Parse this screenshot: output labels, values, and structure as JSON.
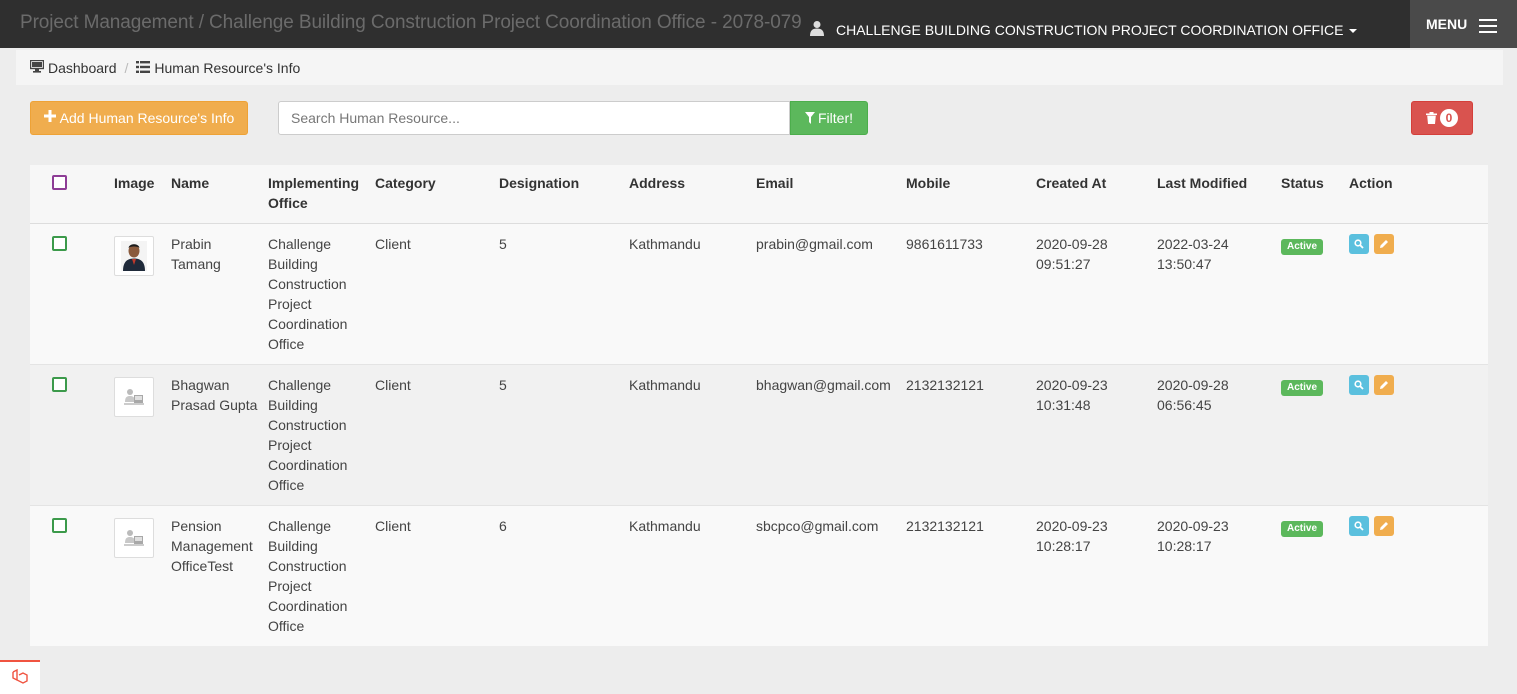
{
  "header": {
    "title": "Project Management / Challenge Building Construction Project Coordination Office - 2078-079",
    "office_menu": "CHALLENGE BUILDING CONSTRUCTION PROJECT COORDINATION OFFICE",
    "menu_label": "MENU"
  },
  "breadcrumb": {
    "dashboard": "Dashboard",
    "separator": "/",
    "current": "Human Resource's Info"
  },
  "toolbar": {
    "add_label": "Add Human Resource's Info",
    "search_placeholder": "Search Human Resource...",
    "filter_label": "Filter!",
    "trash_count": "0"
  },
  "table": {
    "columns": {
      "image": "Image",
      "name": "Name",
      "office": "Implementing Office",
      "category": "Category",
      "designation": "Designation",
      "address": "Address",
      "email": "Email",
      "mobile": "Mobile",
      "created": "Created At",
      "modified": "Last Modified",
      "status": "Status",
      "action": "Action"
    },
    "rows": [
      {
        "name": "Prabin Tamang",
        "office": "Challenge Building Construction Project Coordination Office",
        "category": "Client",
        "designation": "5",
        "address": "Kathmandu",
        "email": "prabin@gmail.com",
        "mobile": "9861611733",
        "created": "2020-09-28 09:51:27",
        "modified": "2022-03-24 13:50:47",
        "status": "Active"
      },
      {
        "name": "Bhagwan Prasad Gupta",
        "office": "Challenge Building Construction Project Coordination Office",
        "category": "Client",
        "designation": "5",
        "address": "Kathmandu",
        "email": "bhagwan@gmail.com",
        "mobile": "2132132121",
        "created": "2020-09-23 10:31:48",
        "modified": "2020-09-28 06:56:45",
        "status": "Active"
      },
      {
        "name": "Pension Management OfficeTest",
        "office": "Challenge Building Construction Project Coordination Office",
        "category": "Client",
        "designation": "6",
        "address": "Kathmandu",
        "email": "sbcpco@gmail.com",
        "mobile": "2132132121",
        "created": "2020-09-23 10:28:17",
        "modified": "2020-09-23 10:28:17",
        "status": "Active"
      }
    ]
  },
  "colors": {
    "add_button": "#f0ad4e",
    "filter_button": "#5cb85c",
    "trash_button": "#d9534f",
    "status_active": "#5cb85c",
    "view_button": "#5bc0de",
    "edit_button": "#f0ad4e",
    "topbar": "#2f2f2f"
  },
  "icons": {
    "user": "user-icon",
    "menu": "hamburger-icon",
    "dashboard": "desktop-icon",
    "list": "list-icon",
    "add": "plus-icon",
    "filter": "filter-icon",
    "trash": "trash-icon",
    "view": "search-icon",
    "edit": "pencil-icon",
    "debug": "laravel-icon"
  }
}
